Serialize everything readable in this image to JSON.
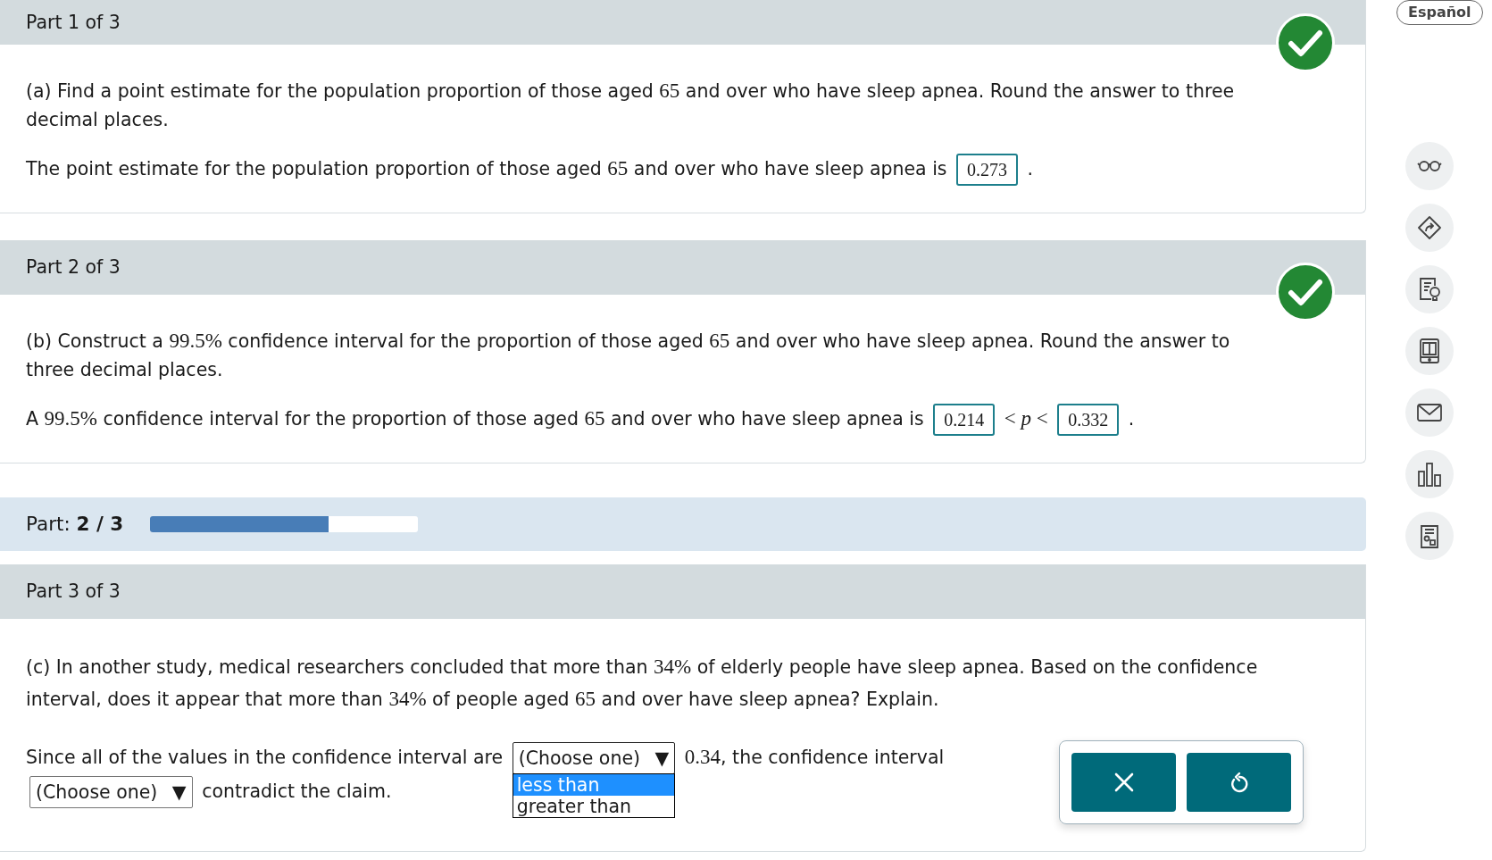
{
  "language_button": "Español",
  "sections": [
    {
      "kind": "part",
      "header": "Part 1 of 3",
      "correct": true,
      "question": [
        {
          "kind": "text",
          "t": "(a) Find a point estimate for the population proportion of those aged "
        },
        {
          "kind": "math",
          "t": "65"
        },
        {
          "kind": "text",
          "t": " and over who have sleep apnea. Round the answer to three decimal places."
        }
      ],
      "answer": [
        {
          "kind": "text",
          "runs": [
            {
              "kind": "text",
              "t": "The point estimate for the population proportion of those aged "
            },
            {
              "kind": "math",
              "t": "65"
            },
            {
              "kind": "text",
              "t": " and over who have sleep apnea is"
            }
          ]
        },
        {
          "kind": "answer",
          "value": "0.273"
        },
        {
          "kind": "text",
          "runs": [
            {
              "kind": "text",
              "t": "."
            }
          ]
        }
      ]
    },
    {
      "kind": "part",
      "header": "Part 2 of 3",
      "correct": true,
      "question": [
        {
          "kind": "text",
          "t": "(b) Construct a "
        },
        {
          "kind": "math",
          "t": "99.5%"
        },
        {
          "kind": "text",
          "t": " confidence interval for the proportion of those aged "
        },
        {
          "kind": "math",
          "t": "65"
        },
        {
          "kind": "text",
          "t": " and over who have sleep apnea. Round the answer to three decimal places."
        }
      ],
      "answer": [
        {
          "kind": "text",
          "runs": [
            {
              "kind": "text",
              "t": "A "
            },
            {
              "kind": "math",
              "t": "99.5%"
            },
            {
              "kind": "text",
              "t": " confidence interval for the proportion of those aged "
            },
            {
              "kind": "math",
              "t": "65"
            },
            {
              "kind": "text",
              "t": " and over who have sleep apnea is"
            }
          ]
        },
        {
          "kind": "answer",
          "value": "0.214"
        },
        {
          "kind": "text",
          "runs": [
            {
              "kind": "math",
              "t": "< *p* <"
            }
          ]
        },
        {
          "kind": "answer",
          "value": "0.332"
        },
        {
          "kind": "text",
          "runs": [
            {
              "kind": "text",
              "t": "."
            }
          ]
        }
      ]
    },
    {
      "kind": "progress",
      "label": "Part:",
      "value": "2 / 3",
      "level": 0.667
    },
    {
      "kind": "part",
      "header": "Part 3 of 3",
      "correct": false,
      "question": [
        {
          "kind": "text",
          "t": "(c) In another study, medical researchers concluded that more than "
        },
        {
          "kind": "math",
          "t": "34%"
        },
        {
          "kind": "text",
          "t": " of elderly people have sleep apnea. Based on the confidence interval, does it appear that more than "
        },
        {
          "kind": "math",
          "t": "34%"
        },
        {
          "kind": "text",
          "t": " of people aged "
        },
        {
          "kind": "math",
          "t": "65"
        },
        {
          "kind": "text",
          "t": " and over have sleep apnea? Explain."
        }
      ],
      "answer": [
        {
          "kind": "text",
          "runs": [
            {
              "kind": "text",
              "t": "Since all of the values in the confidence interval are"
            }
          ]
        },
        {
          "kind": "select",
          "value": "(Choose one)",
          "arrow": "▼",
          "expanded": true,
          "options": [
            {
              "label": "less than",
              "selected": true
            },
            {
              "label": "greater than",
              "selected": false
            }
          ]
        },
        {
          "kind": "text",
          "runs": [
            {
              "kind": "math",
              "t": "0.34"
            },
            {
              "kind": "text",
              "t": ", the confidence interval"
            }
          ]
        },
        {
          "kind": "select",
          "value": "(Choose one)",
          "arrow": "▼"
        },
        {
          "kind": "text",
          "runs": [
            {
              "kind": "text",
              "t": "contradict the claim."
            }
          ]
        }
      ],
      "actions": [
        {
          "kind": "clear"
        },
        {
          "kind": "undo"
        }
      ]
    }
  ],
  "tools": [
    {
      "kind": "glasses"
    },
    {
      "kind": "turn"
    },
    {
      "kind": "hint"
    },
    {
      "kind": "ebook"
    },
    {
      "kind": "mail"
    },
    {
      "kind": "chart"
    },
    {
      "kind": "worksheet"
    }
  ]
}
